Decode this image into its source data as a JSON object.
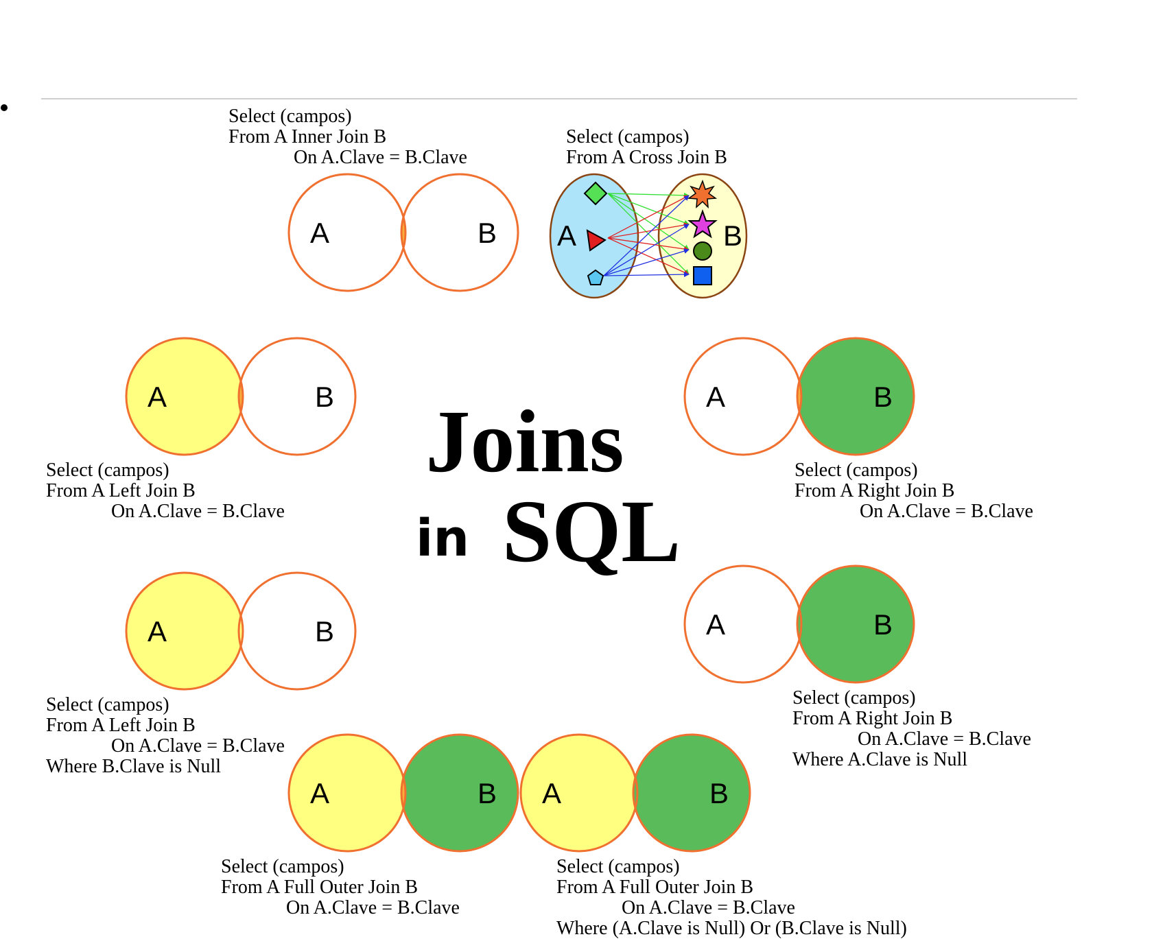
{
  "title": {
    "line1": "Joins",
    "in": "in",
    "sql": "SQL"
  },
  "colors": {
    "ring": "#f07030",
    "yellow": "#ffff80",
    "orange": "#f9ad3a",
    "green": "#5abb5a",
    "crossA": "#aee4f9",
    "crossB": "#ffffcc",
    "crossRing": "#8b4513"
  },
  "diagrams": [
    {
      "id": "inner-join",
      "a": "A",
      "b": "B",
      "fill": {
        "a_only": false,
        "both": true,
        "b_only": false
      },
      "code": [
        "Select  (campos)",
        "From   A  Inner Join  B",
        "On  A.Clave = B.Clave"
      ]
    },
    {
      "id": "left-join",
      "a": "A",
      "b": "B",
      "fill": {
        "a_only": true,
        "both": true,
        "b_only": false
      },
      "code": [
        "Select  (campos)",
        "From   A  Left Join  B",
        "On  A.Clave = B.Clave"
      ]
    },
    {
      "id": "right-join",
      "a": "A",
      "b": "B",
      "fill": {
        "a_only": false,
        "both": true,
        "b_only": true
      },
      "code": [
        "Select  (campos)",
        "From   A  Right Join  B",
        "On  A.Clave = B.Clave"
      ]
    },
    {
      "id": "left-exclusive",
      "a": "A",
      "b": "B",
      "fill": {
        "a_only": true,
        "both": false,
        "b_only": false
      },
      "code": [
        "Select  (campos)",
        "From   A  Left Join  B",
        "On  A.Clave = B.Clave",
        "Where  B.Clave is Null"
      ]
    },
    {
      "id": "right-exclusive",
      "a": "A",
      "b": "B",
      "fill": {
        "a_only": false,
        "both": false,
        "b_only": true
      },
      "code": [
        "Select  (campos)",
        "From   A  Right Join  B",
        "On  A.Clave = B.Clave",
        "Where  A.Clave is Null"
      ]
    },
    {
      "id": "full-outer",
      "a": "A",
      "b": "B",
      "fill": {
        "a_only": true,
        "both": true,
        "b_only": true
      },
      "code": [
        "Select  (campos)",
        "From   A  Full Outer Join  B",
        "On  A.Clave = B.Clave"
      ]
    },
    {
      "id": "full-outer-exclusive",
      "a": "A",
      "b": "B",
      "fill": {
        "a_only": true,
        "both": false,
        "b_only": true
      },
      "code": [
        "Select  (campos)",
        "From   A  Full Outer Join  B",
        "On  A.Clave = B.Clave",
        "Where  (A.Clave is Null)  Or  (B.Clave is Null)"
      ]
    }
  ],
  "cross_join": {
    "a": "A",
    "b": "B",
    "code": [
      "Select  (campos)",
      "From   A  Cross Join  B"
    ],
    "shapes_a": [
      "diamond-icon",
      "triangle-icon",
      "pentagon-icon"
    ],
    "shapes_b": [
      "burst-icon",
      "star-icon",
      "circle-icon",
      "square-icon"
    ]
  }
}
